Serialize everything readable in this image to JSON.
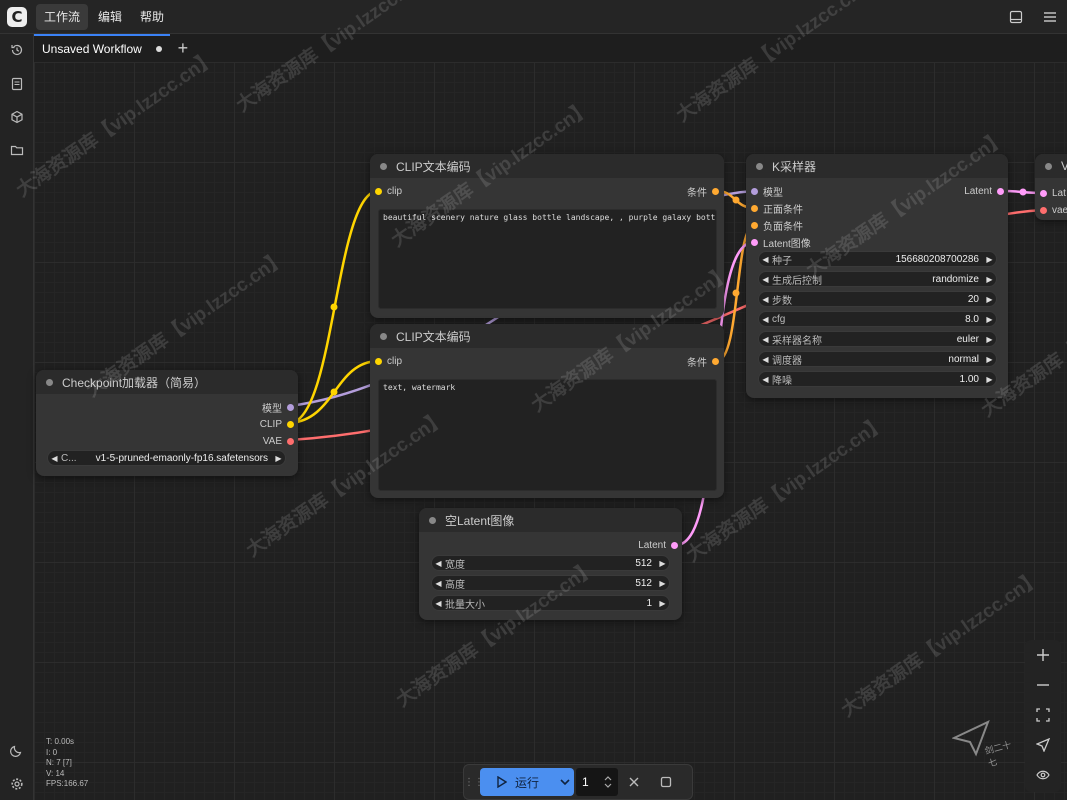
{
  "menu": {
    "items": [
      "工作流",
      "编辑",
      "帮助"
    ]
  },
  "tabs": [
    {
      "label": "Unsaved Workflow"
    }
  ],
  "nodes": {
    "clip1": {
      "title": "CLIP文本编码",
      "in_clip": "clip",
      "out_cond": "条件",
      "text": "beautiful scenery nature glass bottle landscape, , purple galaxy bottle,"
    },
    "clip2": {
      "title": "CLIP文本编码",
      "in_clip": "clip",
      "out_cond": "条件",
      "text": "text, watermark"
    },
    "ckpt": {
      "title": "Checkpoint加载器（简易）",
      "out_model": "模型",
      "out_clip": "CLIP",
      "out_vae": "VAE",
      "widget_label": "C...",
      "widget_value": "v1-5-pruned-emaonly-fp16.safetensors"
    },
    "ksampler": {
      "title": "K采样器",
      "inputs": [
        "模型",
        "正面条件",
        "负面条件",
        "Latent图像"
      ],
      "output": "Latent",
      "widgets": [
        {
          "label": "种子",
          "value": "156680208700286"
        },
        {
          "label": "生成后控制",
          "value": "randomize"
        },
        {
          "label": "步数",
          "value": "20"
        },
        {
          "label": "cfg",
          "value": "8.0"
        },
        {
          "label": "采样器名称",
          "value": "euler"
        },
        {
          "label": "调度器",
          "value": "normal"
        },
        {
          "label": "降噪",
          "value": "1.00"
        }
      ]
    },
    "latent": {
      "title": "空Latent图像",
      "output": "Latent",
      "widgets": [
        {
          "label": "宽度",
          "value": "512"
        },
        {
          "label": "高度",
          "value": "512"
        },
        {
          "label": "批量大小",
          "value": "1"
        }
      ]
    },
    "vae": {
      "title": "V",
      "in_latent": "Lat",
      "in_vae": "vae"
    }
  },
  "runbar": {
    "run_label": "运行",
    "batch_count": "1"
  },
  "stats": [
    "T: 0.00s",
    "I: 0",
    "N: 7 [7]",
    "V: 14",
    "FPS:166.67"
  ],
  "watermarks": {
    "site": "大海资源库【vip.lzzcc.cn】",
    "tool": "剑二十七"
  },
  "colors": {
    "clip": "#ffd500",
    "model": "#b39ddb",
    "vae": "#ff6e6e",
    "cond": "#ffa931",
    "latent": "#ff9cf9",
    "accent": "#4b8ff0"
  }
}
